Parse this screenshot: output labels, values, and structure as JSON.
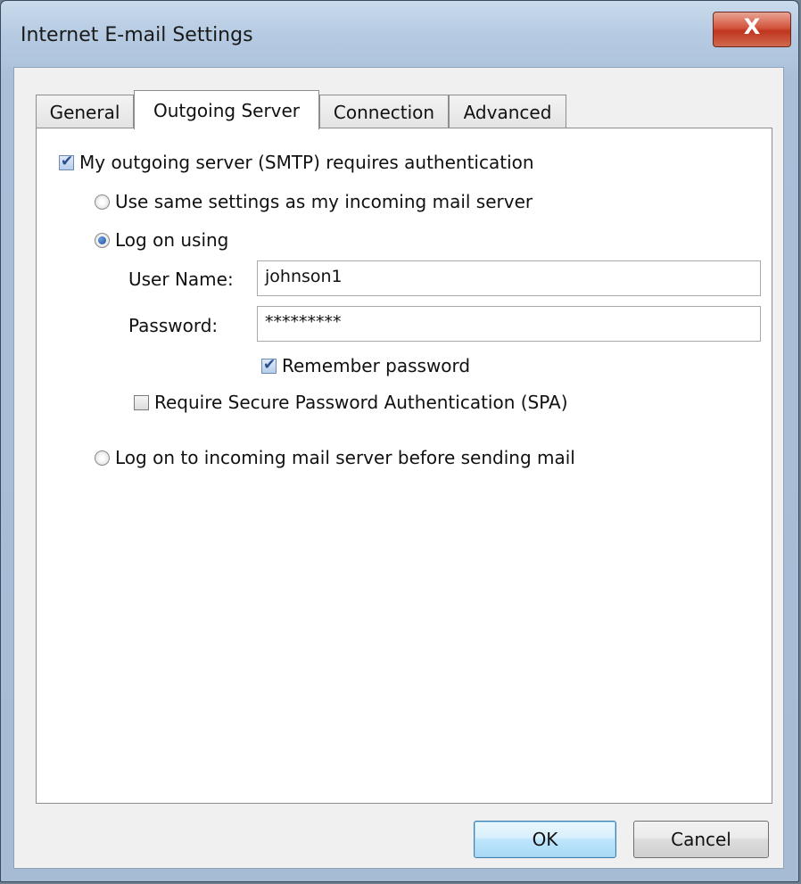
{
  "window": {
    "title": "Internet E-mail Settings",
    "close_glyph": "X"
  },
  "tabs": [
    {
      "label": "General"
    },
    {
      "label": "Outgoing Server"
    },
    {
      "label": "Connection"
    },
    {
      "label": "Advanced"
    }
  ],
  "active_tab": "Outgoing Server",
  "outgoing": {
    "requires_auth_label": "My outgoing server (SMTP) requires authentication",
    "requires_auth_checked": true,
    "option_same_settings": "Use same settings as my incoming mail server",
    "option_log_on_using": "Log on using",
    "selected_option": "Log on using",
    "username_label": "User Name:",
    "username_value": "johnson1",
    "password_label": "Password:",
    "password_value": "*********",
    "remember_password_label": "Remember password",
    "remember_password_checked": true,
    "spa_label": "Require Secure Password Authentication (SPA)",
    "spa_checked": false,
    "option_log_on_incoming": "Log on to incoming mail server before sending mail"
  },
  "buttons": {
    "ok": "OK",
    "cancel": "Cancel"
  },
  "colors": {
    "accent": "#3c7fb1",
    "close": "#c0351e",
    "frame": "#b3c8df"
  }
}
